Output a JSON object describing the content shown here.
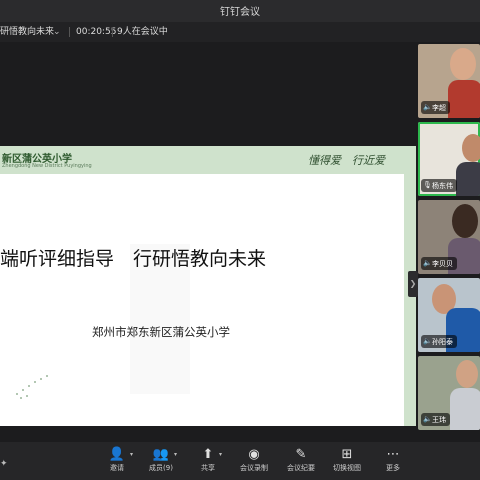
{
  "window": {
    "title": "钉钉会议"
  },
  "meeting": {
    "name": "研悟教向未来",
    "duration": "00:20:55",
    "participants_status": "9人在会议中"
  },
  "slide": {
    "school_name": "新区蒲公英小学",
    "school_name_en": "Zhengdong New District Puyingying",
    "motto": "懂得爱　行近爱",
    "title": "端听评细指导　行研悟教向未来",
    "subtitle": "郑州市郑东新区蒲公英小学"
  },
  "participants": [
    {
      "name": "李超",
      "icon": "speaker-icon"
    },
    {
      "name": "杨东伟",
      "icon": "mic-icon"
    },
    {
      "name": "李贝贝",
      "icon": "speaker-icon"
    },
    {
      "name": "孙阳泰",
      "icon": "speaker-icon"
    },
    {
      "name": "王玮",
      "icon": "speaker-icon"
    }
  ],
  "toolbar": {
    "invite": "邀请",
    "members": "成员(9)",
    "share": "共享",
    "record": "会议录制",
    "minutes": "会议纪要",
    "switch_view": "切换视图",
    "more": "更多"
  },
  "colors": {
    "active_speaker": "#2db84d",
    "slide_banner": "#cfe2cc"
  }
}
